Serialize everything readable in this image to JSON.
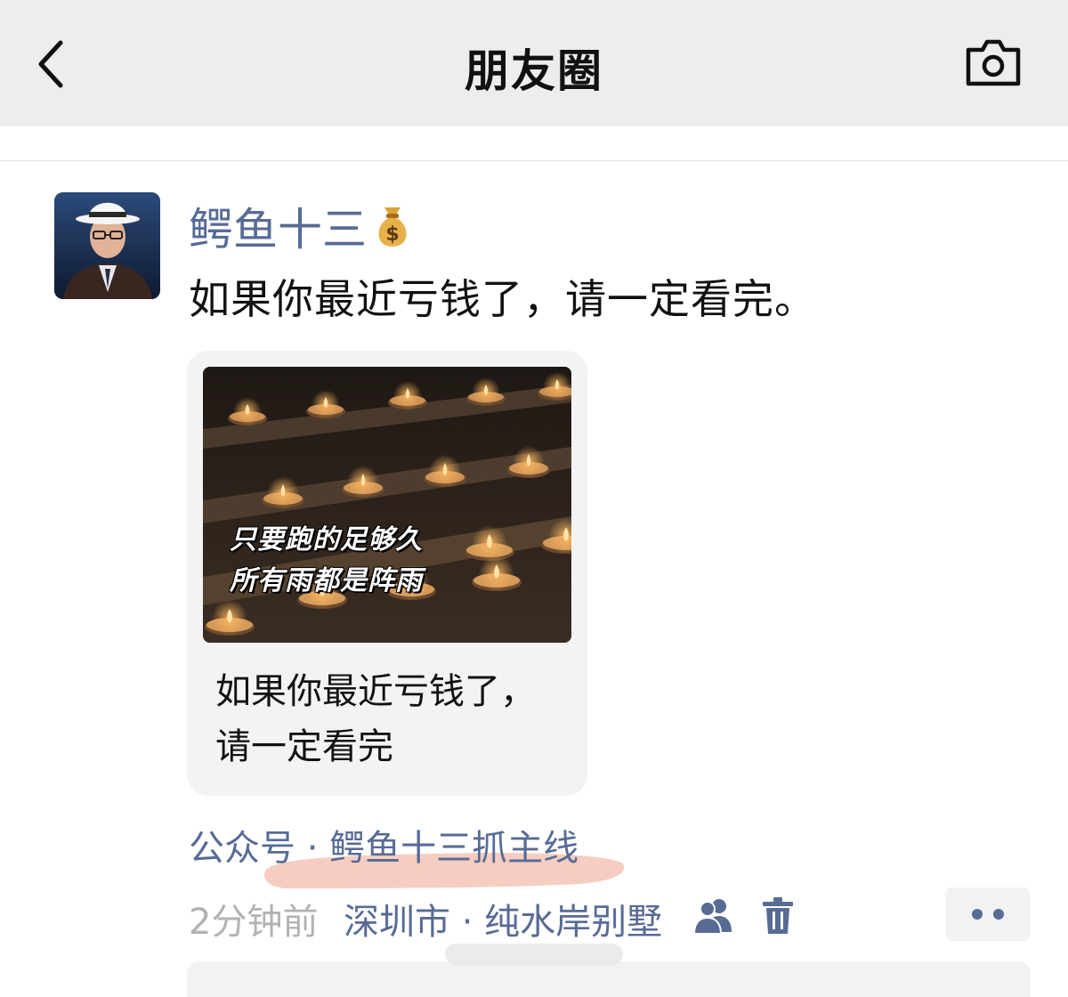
{
  "nav": {
    "title": "朋友圈"
  },
  "post": {
    "author": "鳄鱼十三",
    "author_emoji": "moneybag-icon",
    "text": "如果你最近亏钱了，请一定看完。",
    "article": {
      "thumbnail_caption_line1": "只要跑的足够久",
      "thumbnail_caption_line2": "所有雨都是阵雨",
      "title_line1": "如果你最近亏钱了，",
      "title_line2": "请一定看完"
    },
    "source": "公众号 · 鳄鱼十三抓主线",
    "timestamp": "2分钟前",
    "location": "深圳市 · 纯水岸别墅"
  },
  "colors": {
    "link_blue": "#576b95",
    "nav_bg": "#ededed",
    "highlight": "#f6c4b6",
    "timestamp_gray": "#b2b2b2"
  },
  "icons": [
    "back-arrow-icon",
    "camera-icon",
    "moneybag-icon",
    "privacy-friends-icon",
    "trash-icon",
    "more-dots-icon"
  ]
}
